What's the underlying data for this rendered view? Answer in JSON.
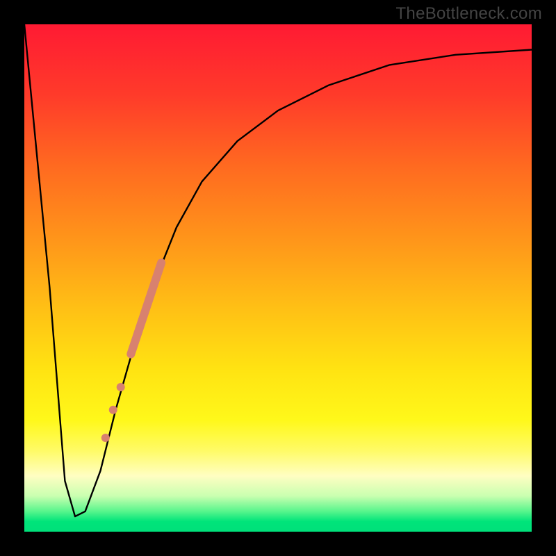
{
  "watermark": "TheBottleneck.com",
  "chart_data": {
    "type": "line",
    "title": "",
    "xlabel": "",
    "ylabel": "",
    "xlim": [
      0,
      100
    ],
    "ylim": [
      0,
      100
    ],
    "series": [
      {
        "name": "bottleneck-curve",
        "x": [
          0,
          5,
          8,
          10,
          12,
          15,
          18,
          22,
          26,
          30,
          35,
          42,
          50,
          60,
          72,
          85,
          100
        ],
        "y": [
          100,
          48,
          10,
          3,
          4,
          12,
          24,
          38,
          50,
          60,
          69,
          77,
          83,
          88,
          92,
          94,
          95
        ]
      }
    ],
    "markers": [
      {
        "name": "segment1",
        "type": "line_segment",
        "x0": 21,
        "y0": 35,
        "x1": 27,
        "y1": 53,
        "color": "#d8816f",
        "width": 12
      },
      {
        "name": "dot1",
        "type": "dot",
        "x": 19.0,
        "y": 28.5,
        "r": 6,
        "color": "#d8816f"
      },
      {
        "name": "dot2",
        "type": "dot",
        "x": 17.5,
        "y": 24.0,
        "r": 6,
        "color": "#d8816f"
      },
      {
        "name": "dot3",
        "type": "dot",
        "x": 16.0,
        "y": 18.5,
        "r": 6,
        "color": "#d8816f"
      }
    ]
  }
}
